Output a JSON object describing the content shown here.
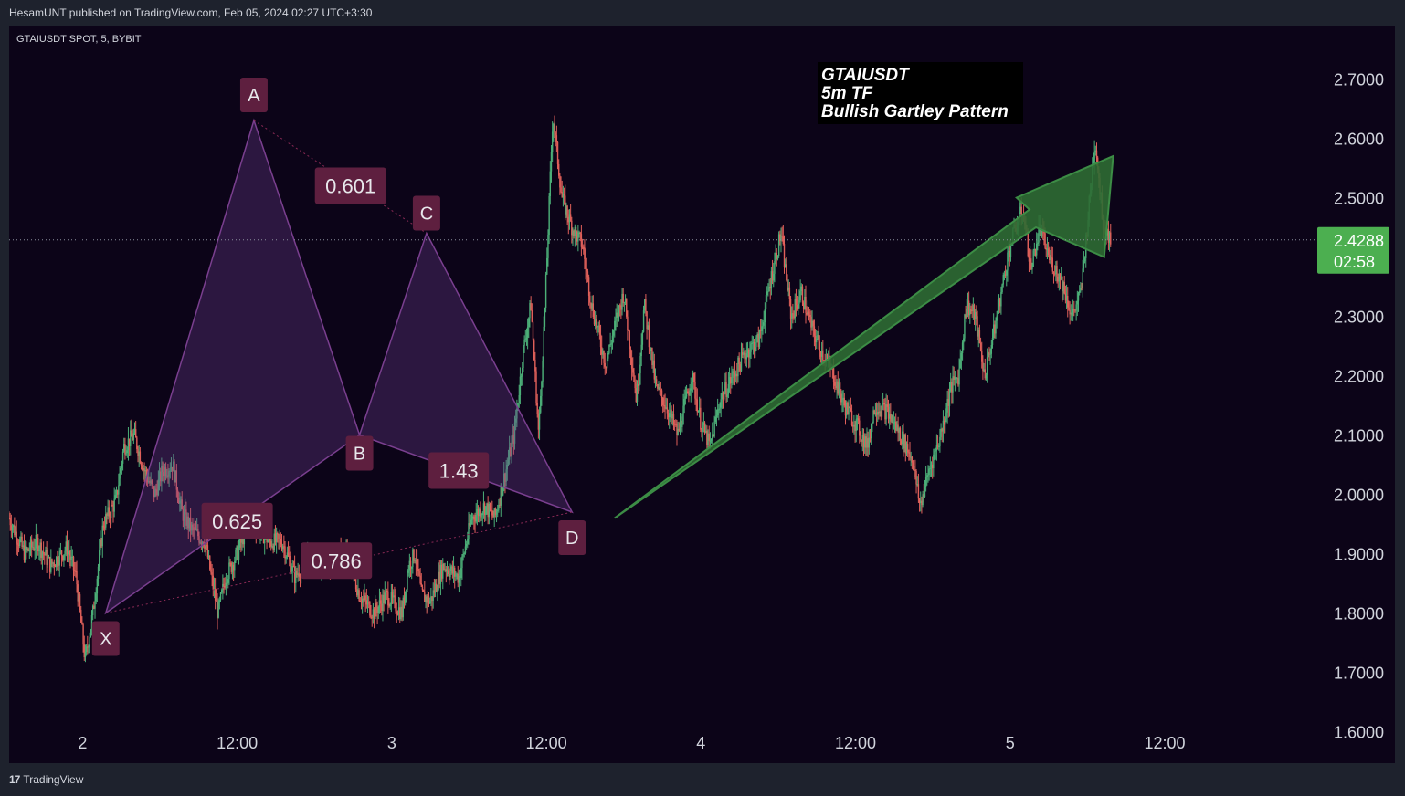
{
  "header": {
    "published": "HesamUNT published on TradingView.com, Feb 05, 2024 02:27 UTC+3:30"
  },
  "footer": {
    "brand": "TradingView",
    "logo_glyph": "17"
  },
  "colors": {
    "background": "#0c0418",
    "pattern_fill": "#6a3c8c",
    "label_bg": "#5e1f3f",
    "arrow_fill": "#2e6b33",
    "price_badge": "#4caf50",
    "candle_up": "#4caf78",
    "candle_down": "#e0605a"
  },
  "chart_data": {
    "type": "candlestick",
    "symbol_line": "GTAIUSDT SPOT, 5, BYBIT",
    "annotation": [
      "GTAIUSDT",
      "5m TF",
      "Bullish Gartley Pattern"
    ],
    "y_ticks": [
      "2.7000",
      "2.6000",
      "2.5000",
      "2.3000",
      "2.2000",
      "2.1000",
      "2.0000",
      "1.9000",
      "1.8000",
      "1.7000",
      "1.6000"
    ],
    "y_tick_values": [
      2.7,
      2.6,
      2.5,
      2.3,
      2.2,
      2.1,
      2.0,
      1.9,
      1.8,
      1.7,
      1.6
    ],
    "ylim": [
      1.59,
      2.79
    ],
    "x_ticks": [
      "2",
      "12:00",
      "3",
      "12:00",
      "4",
      "12:00",
      "5",
      "12:00"
    ],
    "x_tick_hours": [
      0,
      12,
      24,
      36,
      48,
      60,
      72,
      84
    ],
    "x_range_hours": [
      -5.7,
      95.7
    ],
    "last_price": {
      "value": 2.4288,
      "label": "2.4288",
      "countdown": "02:58"
    },
    "pattern": {
      "name": "Bullish Gartley",
      "points": [
        {
          "name": "X",
          "hour": 1.8,
          "price": 1.8
        },
        {
          "name": "A",
          "hour": 13.3,
          "price": 2.63
        },
        {
          "name": "B",
          "hour": 21.5,
          "price": 2.1
        },
        {
          "name": "C",
          "hour": 26.7,
          "price": 2.44
        },
        {
          "name": "D",
          "hour": 38.0,
          "price": 1.97
        }
      ],
      "ratios": [
        {
          "label": "0.601",
          "hour": 20.8,
          "price": 2.52
        },
        {
          "label": "0.625",
          "hour": 12.0,
          "price": 1.955
        },
        {
          "label": "1.43",
          "hour": 29.2,
          "price": 2.04
        },
        {
          "label": "0.786",
          "hour": 19.7,
          "price": 1.888
        }
      ]
    },
    "trend_path": [
      [
        -5.7,
        1.96
      ],
      [
        -4.5,
        1.9
      ],
      [
        -3.5,
        1.92
      ],
      [
        -2.5,
        1.88
      ],
      [
        -1.2,
        1.91
      ],
      [
        -0.5,
        1.86
      ],
      [
        0.2,
        1.72
      ],
      [
        0.8,
        1.8
      ],
      [
        1.6,
        1.95
      ],
      [
        2.6,
        1.99
      ],
      [
        3.2,
        2.08
      ],
      [
        4.0,
        2.1
      ],
      [
        4.8,
        2.04
      ],
      [
        5.6,
        2.0
      ],
      [
        6.2,
        2.04
      ],
      [
        7.0,
        2.05
      ],
      [
        7.7,
        1.97
      ],
      [
        8.5,
        1.94
      ],
      [
        9.5,
        1.92
      ],
      [
        10.5,
        1.8
      ],
      [
        11.1,
        1.86
      ],
      [
        12.0,
        1.9
      ],
      [
        13.0,
        1.96
      ],
      [
        14.5,
        1.92
      ],
      [
        15.5,
        1.92
      ],
      [
        16.5,
        1.86
      ],
      [
        17.5,
        1.9
      ],
      [
        18.5,
        1.88
      ],
      [
        19.5,
        1.89
      ],
      [
        20.5,
        1.9
      ],
      [
        21.5,
        1.83
      ],
      [
        22.6,
        1.8
      ],
      [
        23.6,
        1.83
      ],
      [
        24.8,
        1.8
      ],
      [
        25.3,
        1.88
      ],
      [
        25.8,
        1.9
      ],
      [
        26.3,
        1.83
      ],
      [
        27.0,
        1.82
      ],
      [
        28.0,
        1.88
      ],
      [
        29.2,
        1.86
      ],
      [
        30.2,
        1.96
      ],
      [
        31.2,
        1.98
      ],
      [
        32.0,
        1.96
      ],
      [
        33.5,
        2.1
      ],
      [
        34.2,
        2.24
      ],
      [
        34.8,
        2.32
      ],
      [
        35.4,
        2.1
      ],
      [
        35.9,
        2.32
      ],
      [
        36.5,
        2.64
      ],
      [
        37.2,
        2.5
      ],
      [
        38.0,
        2.45
      ],
      [
        38.8,
        2.42
      ],
      [
        39.5,
        2.32
      ],
      [
        40.6,
        2.22
      ],
      [
        41.5,
        2.3
      ],
      [
        42.0,
        2.34
      ],
      [
        43.0,
        2.16
      ],
      [
        43.6,
        2.32
      ],
      [
        44.5,
        2.18
      ],
      [
        45.3,
        2.15
      ],
      [
        46.2,
        2.1
      ],
      [
        47.3,
        2.2
      ],
      [
        48.0,
        2.12
      ],
      [
        48.7,
        2.08
      ],
      [
        49.5,
        2.16
      ],
      [
        50.5,
        2.2
      ],
      [
        51.5,
        2.24
      ],
      [
        52.5,
        2.26
      ],
      [
        53.3,
        2.35
      ],
      [
        54.2,
        2.44
      ],
      [
        55.0,
        2.3
      ],
      [
        55.8,
        2.34
      ],
      [
        56.6,
        2.28
      ],
      [
        57.4,
        2.24
      ],
      [
        58.3,
        2.2
      ],
      [
        59.1,
        2.15
      ],
      [
        60.0,
        2.12
      ],
      [
        60.9,
        2.08
      ],
      [
        61.5,
        2.15
      ],
      [
        62.4,
        2.14
      ],
      [
        63.5,
        2.1
      ],
      [
        64.4,
        2.06
      ],
      [
        65.0,
        1.98
      ],
      [
        65.7,
        2.04
      ],
      [
        66.6,
        2.1
      ],
      [
        67.4,
        2.18
      ],
      [
        68.0,
        2.2
      ],
      [
        68.6,
        2.32
      ],
      [
        69.3,
        2.3
      ],
      [
        70.0,
        2.2
      ],
      [
        70.8,
        2.28
      ],
      [
        71.8,
        2.4
      ],
      [
        72.4,
        2.45
      ],
      [
        73.0,
        2.48
      ],
      [
        73.6,
        2.38
      ],
      [
        74.3,
        2.45
      ],
      [
        75.0,
        2.4
      ],
      [
        76.0,
        2.36
      ],
      [
        76.8,
        2.3
      ],
      [
        77.5,
        2.34
      ],
      [
        78.1,
        2.48
      ],
      [
        78.6,
        2.6
      ],
      [
        79.2,
        2.46
      ],
      [
        79.8,
        2.43
      ]
    ],
    "forecast_arrow": [
      [
        41.3,
        1.96
      ],
      [
        73.5,
        2.48
      ],
      [
        72.5,
        2.5
      ],
      [
        80.0,
        2.57
      ],
      [
        79.3,
        2.4
      ],
      [
        74.0,
        2.45
      ]
    ]
  }
}
